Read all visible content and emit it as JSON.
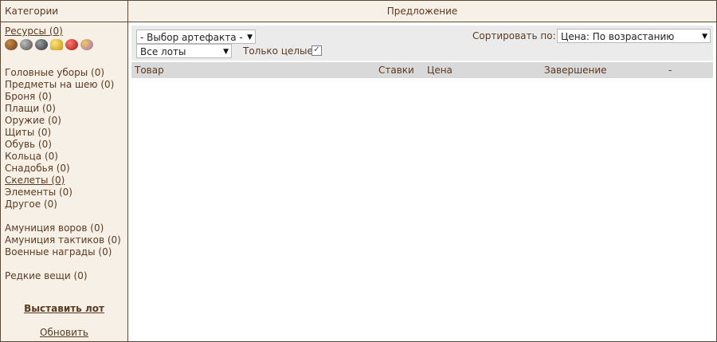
{
  "sidebar": {
    "header": "Категории",
    "resources_link": "Ресурсы (0)",
    "resource_icons": [
      {
        "name": "wood-icon",
        "color": "#8b5a2b"
      },
      {
        "name": "ore-icon",
        "color": "#6b6b6b"
      },
      {
        "name": "mercury-icon",
        "color": "#4a4a4a"
      },
      {
        "name": "sulfur-icon",
        "color": "#d7b327"
      },
      {
        "name": "crystal-icon",
        "color": "#c0262a"
      },
      {
        "name": "gems-icon",
        "color": "#b88ed6"
      }
    ],
    "categories": [
      {
        "label": "Головные уборы (0)"
      },
      {
        "label": "Предметы на шею (0)"
      },
      {
        "label": "Броня (0)"
      },
      {
        "label": "Плащи (0)"
      },
      {
        "label": "Оружие (0)"
      },
      {
        "label": "Щиты (0)"
      },
      {
        "label": "Обувь (0)"
      },
      {
        "label": "Кольца (0)"
      },
      {
        "label": "Снадобья (0)"
      },
      {
        "label": "Скелеты (0)"
      },
      {
        "label": "Элементы (0)"
      },
      {
        "label": "Другое (0)"
      }
    ],
    "extra_categories": [
      {
        "label": "Амуниция воров (0)"
      },
      {
        "label": "Амуниция тактиков (0)"
      },
      {
        "label": "Военные награды (0)"
      }
    ],
    "rare": {
      "label": "Редкие вещи (0)"
    },
    "sell_lot": "Выставить лот",
    "refresh": "Обновить"
  },
  "main": {
    "header": "Предложение",
    "artifact_select": "- Выбор артефакта -",
    "lots_select": "Все лоты",
    "only_whole_label": "Только целые",
    "only_whole_checked": true,
    "sort_label": "Сортировать по:",
    "sort_select": "Цена: По возрастанию",
    "columns": {
      "item": "Товар",
      "bids": "Ставки",
      "price": "Цена",
      "end": "Завершение",
      "dash": "-"
    }
  },
  "colors": {
    "panel_bg": "#f6f0e6",
    "text": "#5a3a22",
    "filter_bg": "#ebebeb",
    "table_header_bg": "#d9d9d9",
    "border": "#5a4a3a"
  }
}
